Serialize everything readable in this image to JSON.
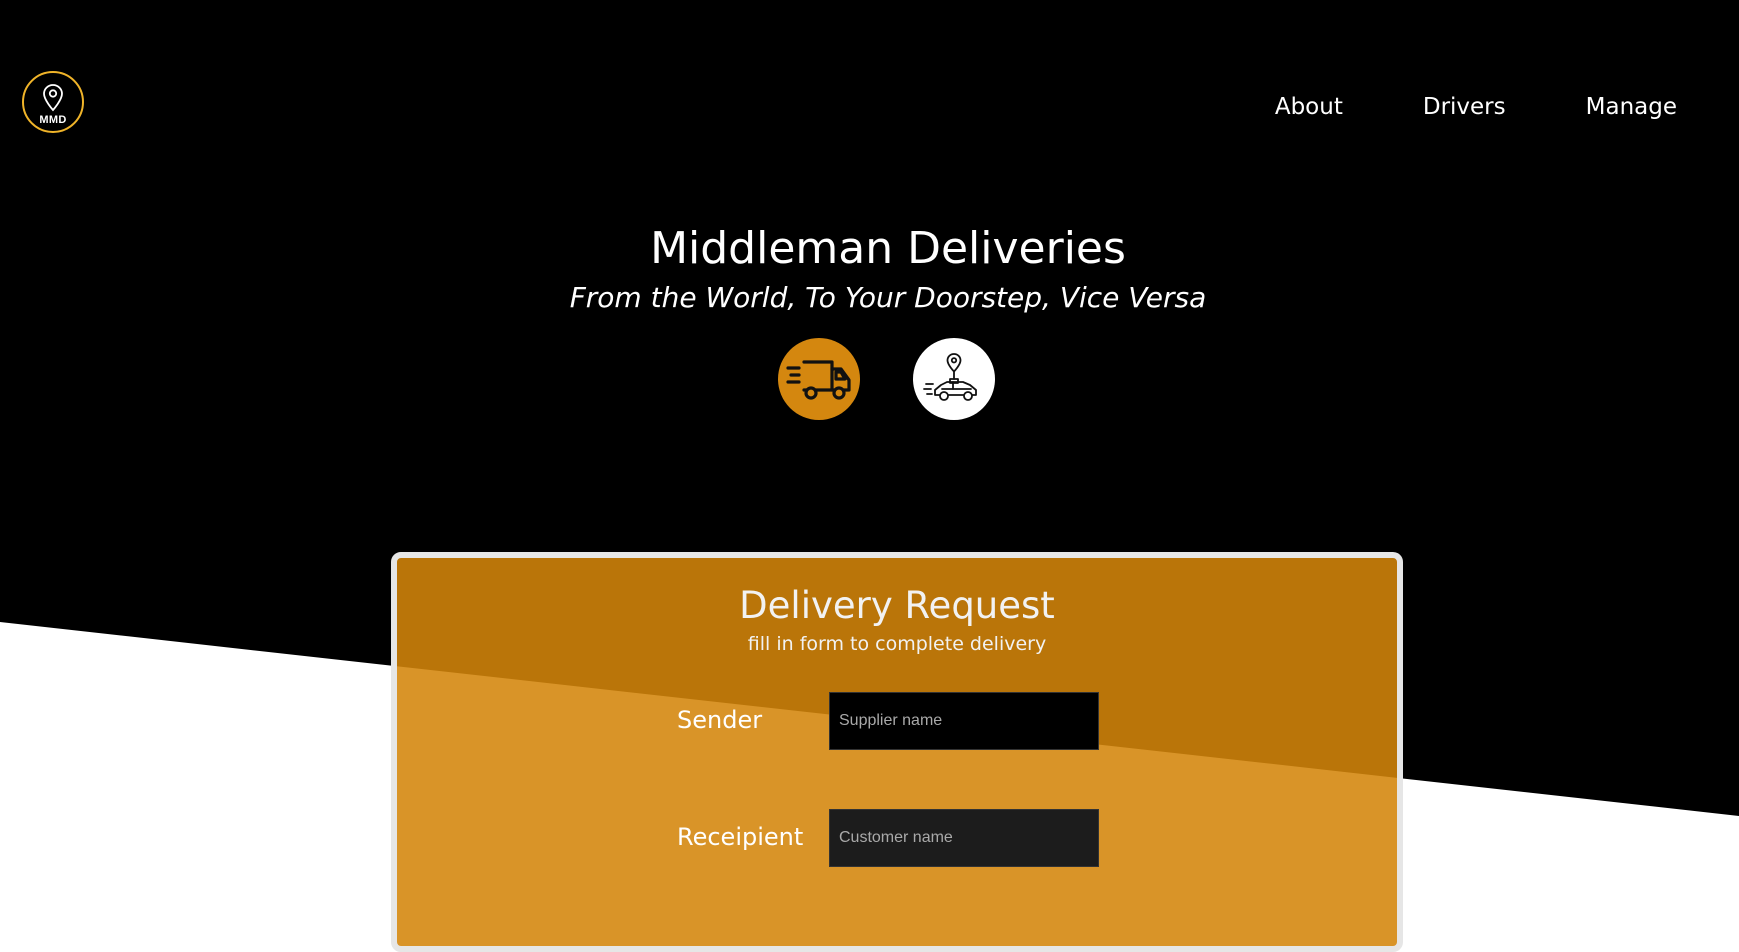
{
  "logo": {
    "text": "MMD",
    "icon": "location-pin-icon",
    "ring_color": "#f0b429"
  },
  "nav": {
    "items": [
      {
        "label": "About"
      },
      {
        "label": "Drivers"
      },
      {
        "label": "Manage"
      }
    ]
  },
  "hero": {
    "title": "Middleman Deliveries",
    "subtitle": "From the World, To Your Doorstep, Vice Versa",
    "icons": [
      {
        "name": "delivery-truck-icon",
        "background": "#d4870f"
      },
      {
        "name": "taxi-location-icon",
        "background": "#ffffff"
      }
    ]
  },
  "form": {
    "title": "Delivery Request",
    "subtitle": "fill in form to complete delivery",
    "fields": [
      {
        "label": "Sender",
        "placeholder": "Supplier name",
        "value": ""
      },
      {
        "label": "Receipient",
        "placeholder": "Customer name",
        "value": ""
      }
    ]
  },
  "colors": {
    "background_dark": "#000000",
    "background_light": "#ffffff",
    "accent": "#d4870f",
    "card_border": "#e6e6e6"
  }
}
